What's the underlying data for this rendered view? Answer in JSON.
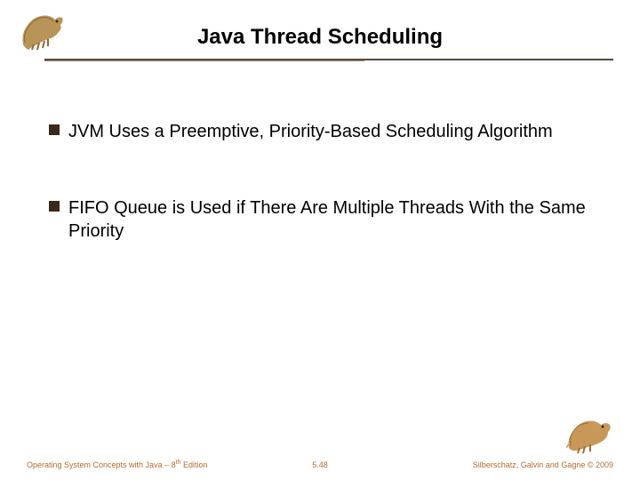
{
  "title": "Java Thread Scheduling",
  "bullets": [
    "JVM Uses a Preemptive, Priority-Based Scheduling Algorithm",
    "FIFO Queue is Used if There Are Multiple Threads With the Same Priority"
  ],
  "footer": {
    "left_prefix": "Operating System Concepts with Java – 8",
    "left_sup": "th",
    "left_suffix": " Edition",
    "center": "5.48",
    "right": "Silberschatz, Galvin and Gagne © 2009"
  }
}
